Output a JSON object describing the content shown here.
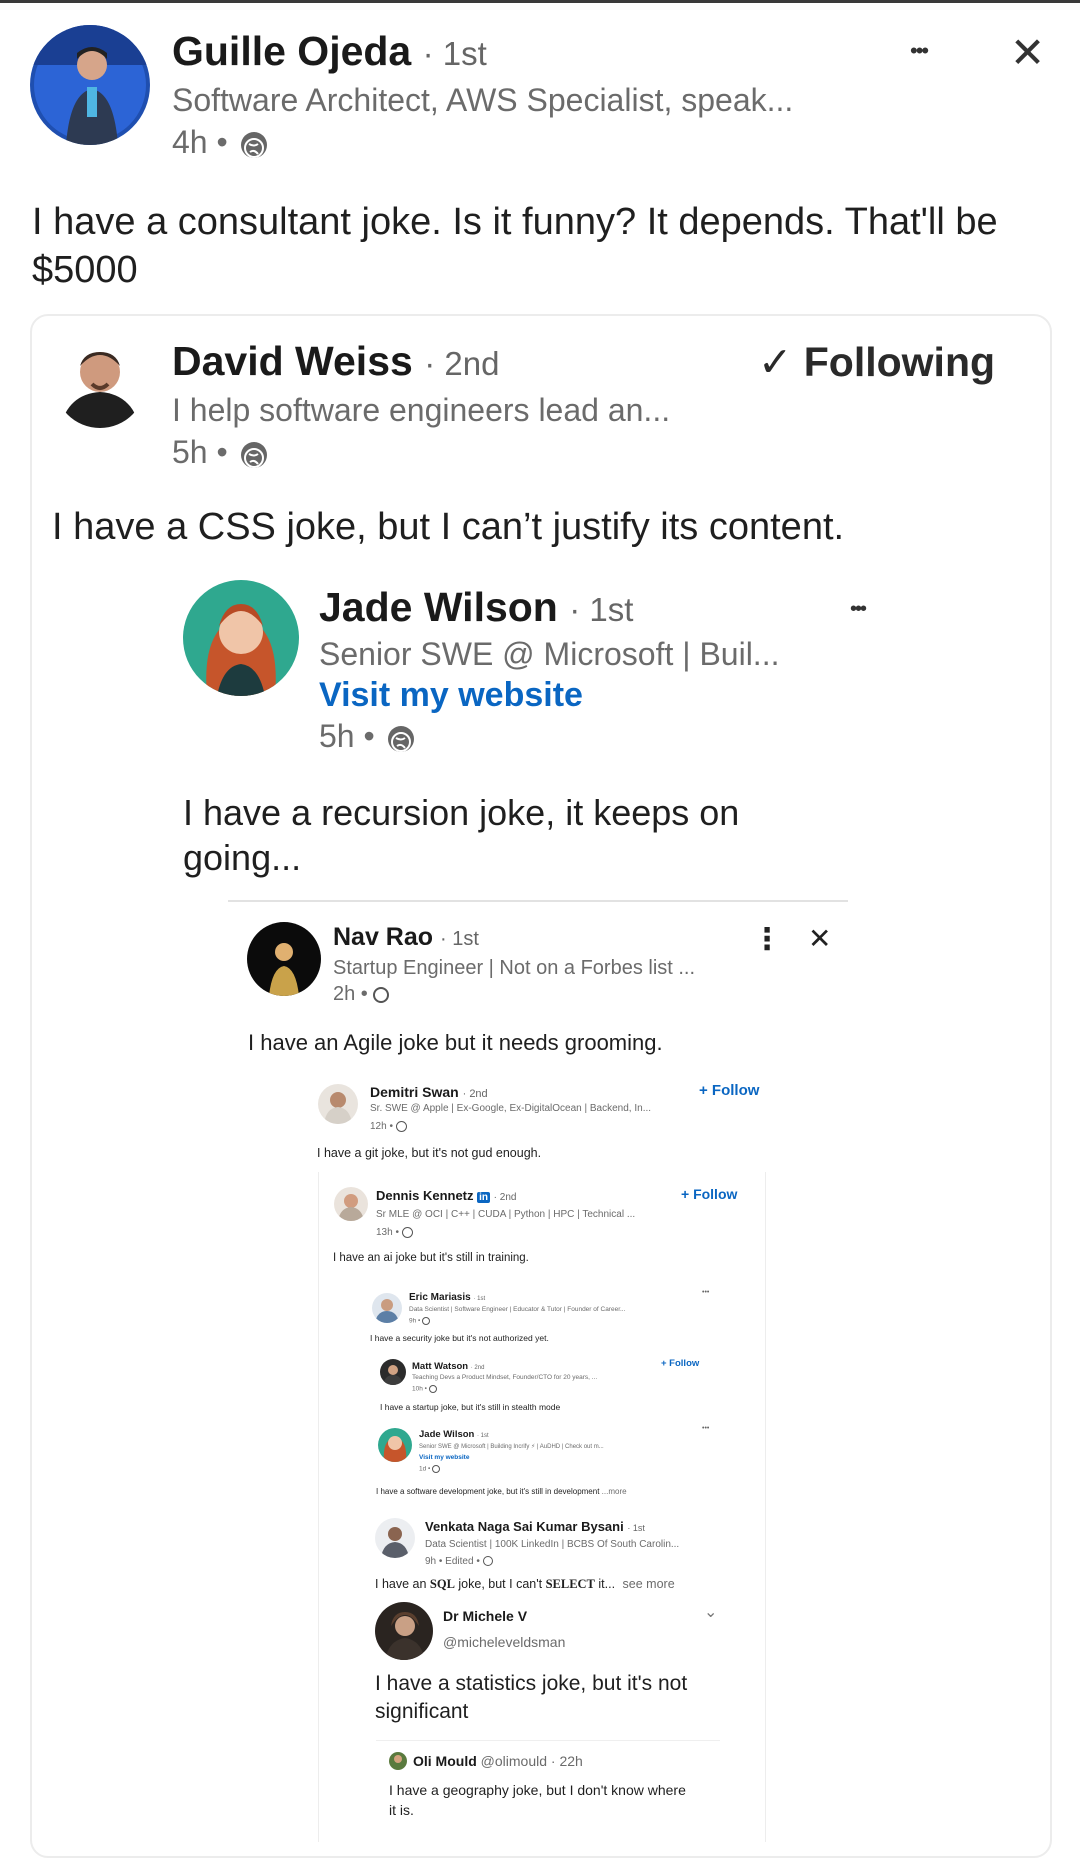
{
  "post": {
    "author": "Guille Ojeda",
    "degree": "· 1st",
    "headline": "Software Architect, AWS Specialist, speak...",
    "time": "4h •",
    "body": "I have a consultant joke. Is it funny? It depends. That'll be $5000",
    "more_glyph": "•••",
    "close_glyph": "✕"
  },
  "repost1": {
    "author": "David Weiss",
    "degree": "· 2nd",
    "follow": "✓ Following",
    "headline": "I help software engineers lead an...",
    "time": "5h •",
    "body": "I have a CSS joke, but I can’t justify its content."
  },
  "repost2": {
    "author": "Jade Wilson",
    "degree": "· 1st",
    "headline": "Senior SWE @ Microsoft | Buil...",
    "link": "Visit my website",
    "time": "5h •",
    "body": "I have a recursion joke, it keeps on going...",
    "more_glyph": "•••"
  },
  "repost3": {
    "author": "Nav Rao",
    "degree": "· 1st",
    "headline": "Startup Engineer | Not on a Forbes list ...",
    "time": "2h •",
    "body": "I have an Agile joke but it needs grooming.",
    "more_glyph": "⋮",
    "close_glyph": "✕"
  },
  "repost4": {
    "author": "Demitri Swan",
    "degree": "· 2nd",
    "follow": "+ Follow",
    "headline": "Sr. SWE @ Apple | Ex-Google, Ex-DigitalOcean | Backend, In...",
    "time": "12h •",
    "body": "I have a git joke, but it's not gud enough."
  },
  "repost5": {
    "author": "Dennis Kennetz",
    "badge": "in",
    "degree": "· 2nd",
    "follow": "+ Follow",
    "headline": "Sr MLE @ OCI | C++ | CUDA | Python | HPC | Technical ...",
    "time": "13h •",
    "body": "I have an ai joke but it's still in training."
  },
  "repost6": {
    "author": "Eric Mariasis",
    "degree": "· 1st",
    "headline": "Data Scientist | Software Engineer | Educator & Tutor | Founder of Career...",
    "time": "9h •",
    "body": "I have a security joke but it's not authorized yet.",
    "more_glyph": "•••"
  },
  "repost7": {
    "author": "Matt Watson",
    "degree": "· 2nd",
    "follow": "+ Follow",
    "headline": "Teaching Devs a Product Mindset, Founder/CTO for 20 years, ...",
    "time": "10h •",
    "body": "I have a startup joke, but it's still in stealth mode"
  },
  "repost8": {
    "author": "Jade Wilson",
    "degree": "· 1st",
    "headline": "Senior SWE @ Microsoft | Building Incrify ⚡ | AuDHD | Check out m...",
    "link": "Visit my website",
    "time": "1d •",
    "body": "I have a software development joke, but it's still in development",
    "more": "...more",
    "more_glyph": "•••"
  },
  "repost9": {
    "author": "Venkata Naga Sai Kumar Bysani",
    "degree": "· 1st",
    "headline": "Data Scientist | 100K LinkedIn | BCBS Of South Carolin...",
    "time": "9h • Edited •",
    "body_pre": "I have an ",
    "body_sql": "SQL",
    "body_mid": " joke, but I can't ",
    "body_select": "SELECT",
    "body_post": " it...",
    "see_more": "see more"
  },
  "tweet1": {
    "author": "Dr Michele V",
    "handle": "@micheleveldsman",
    "body": "I have a statistics joke, but it's not significant",
    "chevron": "⌄"
  },
  "tweet2": {
    "author": "Oli Mould",
    "handle": "@olimould · 22h",
    "body": "I have a geography joke, but I don't know where it is."
  },
  "colors": {
    "link": "#0a66c2",
    "text": "#191919",
    "muted": "#6b6b6b"
  }
}
